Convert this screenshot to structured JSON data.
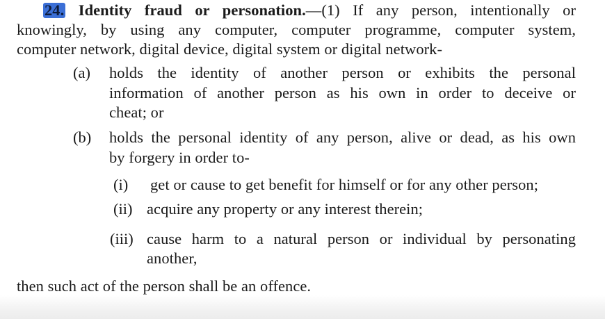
{
  "section": {
    "number": "24.",
    "heading": "Identity fraud or personation.",
    "intro_rest": "—(1) If any person, intentionally or",
    "intro_line2": "knowingly, by using any computer, computer programme, computer system,",
    "intro_line3": "computer network, digital device, digital system or digital network-"
  },
  "clauses": [
    {
      "label": "(a)",
      "lines": [
        "holds the identity of another person or exhibits the personal",
        "information of another person as his own in order to deceive or",
        "cheat; or"
      ]
    },
    {
      "label": "(b)",
      "lines": [
        "holds the personal identity of any person, alive or dead, as his own",
        "by forgery in order to-"
      ]
    }
  ],
  "subclauses": [
    {
      "label": "(i)",
      "lines": [
        "get or cause to get benefit for himself or for any other person;"
      ]
    },
    {
      "label": "(ii)",
      "lines": [
        "acquire any property or any interest therein;"
      ]
    },
    {
      "label": "(iii)",
      "lines": [
        "cause harm to a natural person or individual by personating",
        "another,"
      ]
    }
  ],
  "closing": "then such act of the person shall be an offence."
}
